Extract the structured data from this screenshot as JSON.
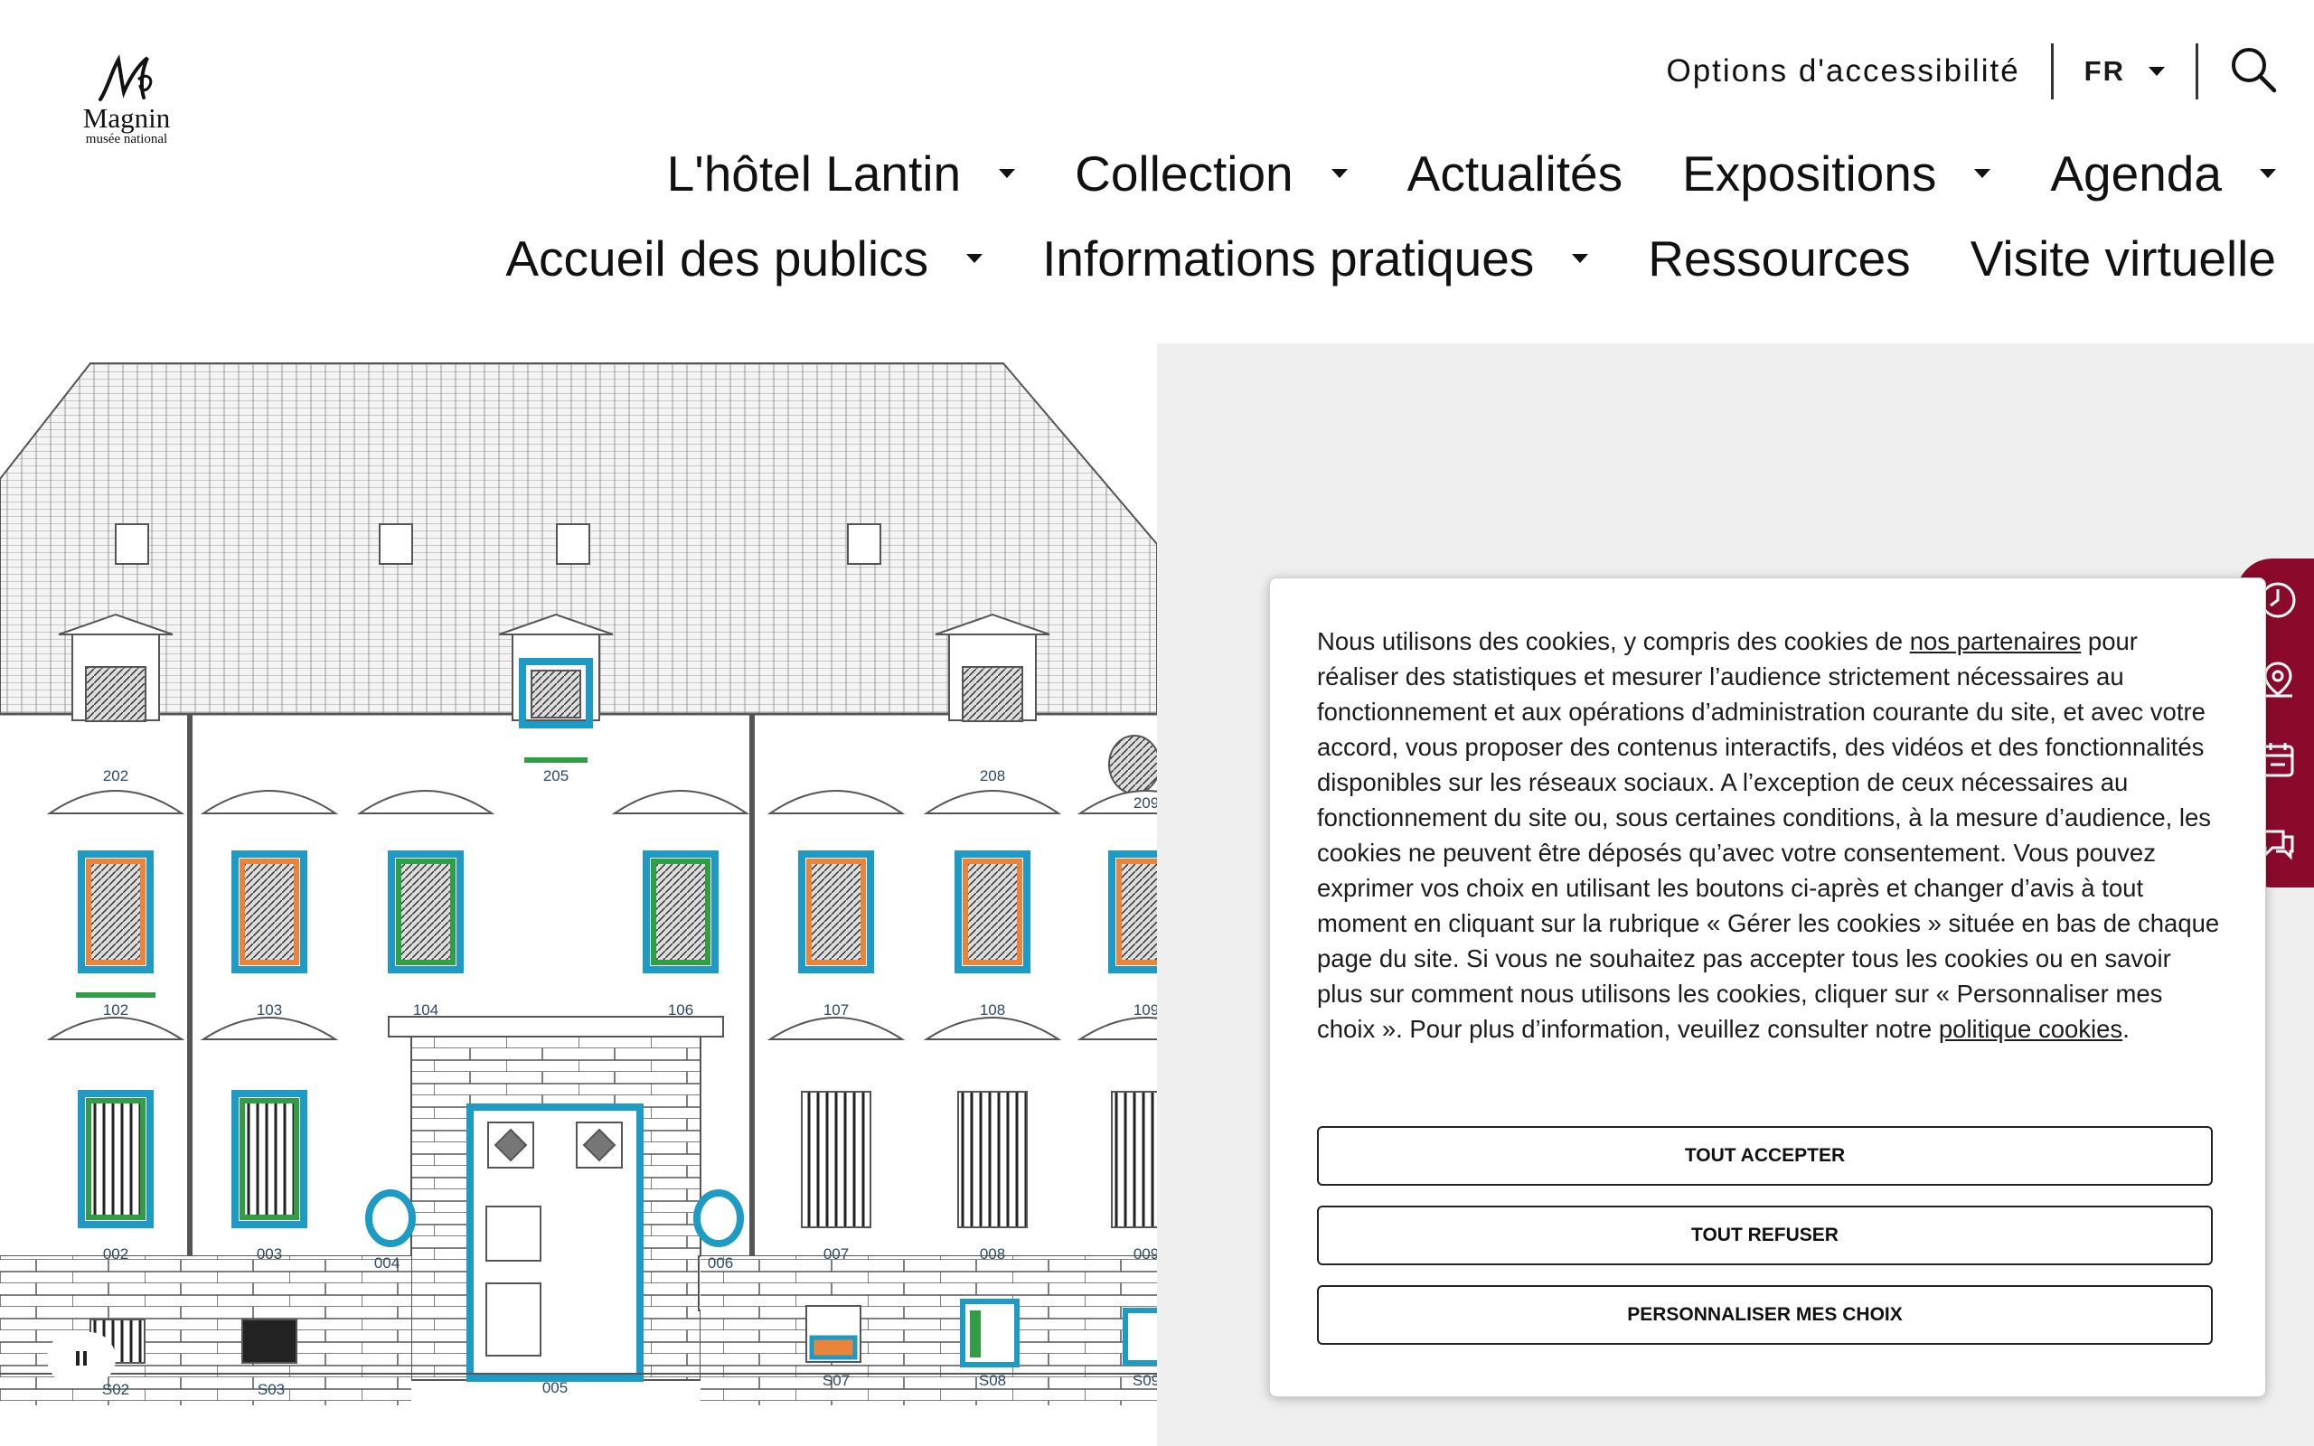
{
  "brand": {
    "monogram": "M",
    "name": "Magnin",
    "subtitle": "musée national"
  },
  "utility": {
    "accessibility": "Options d'accessibilité",
    "language": "FR"
  },
  "nav": {
    "row1": [
      {
        "label": "L'hôtel Lantin",
        "dropdown": true
      },
      {
        "label": "Collection",
        "dropdown": true
      },
      {
        "label": "Actualités",
        "dropdown": false
      },
      {
        "label": "Expositions",
        "dropdown": true
      },
      {
        "label": "Agenda",
        "dropdown": true
      }
    ],
    "row2": [
      {
        "label": "Accueil des publics",
        "dropdown": true
      },
      {
        "label": "Informations pratiques",
        "dropdown": true
      },
      {
        "label": "Ressources",
        "dropdown": false
      },
      {
        "label": "Visite virtuelle",
        "dropdown": false
      }
    ]
  },
  "facade": {
    "labels": {
      "l202": "202",
      "l205": "205",
      "l208": "208",
      "l209": "209",
      "l102": "102",
      "l103": "103",
      "l104": "104",
      "l106": "106",
      "l107": "107",
      "l108": "108",
      "l109": "109",
      "l002": "002",
      "l003": "003",
      "l004": "004",
      "l006": "006",
      "l007": "007",
      "l008": "008",
      "l009": "009",
      "ls02": "S02",
      "ls03": "S03",
      "l005": "005",
      "ls07": "S07",
      "ls08": "S08",
      "ls09": "S09"
    }
  },
  "cookie": {
    "part1": "Nous utilisons des cookies, y compris des cookies de ",
    "link_partners": "nos partenaires",
    "part2": " pour réaliser des statistiques et mesurer l’audience strictement nécessaires au fonctionnement et aux opérations d’administration courante du site, et avec votre accord, vous proposer des contenus interactifs, des vidéos et des fonctionnalités disponibles sur les réseaux sociaux. A l’exception de ceux nécessaires au fonctionnement du site ou, sous certaines conditions, à la mesure d’audience, les cookies ne peuvent être déposés qu’avec votre consentement. Vous pouvez exprimer vos choix en utilisant les boutons ci-après et changer d’avis à tout moment en cliquant sur la rubrique « Gérer les cookies » située en bas de chaque page du site. Si vous ne souhaitez pas accepter tous les cookies ou en savoir plus sur comment nous utilisons les cookies, cliquer sur « Personnaliser mes choix ». Pour plus d’information, veuillez consulter notre ",
    "link_policy": "politique cookies",
    "part3": ".",
    "accept": "TOUT ACCEPTER",
    "refuse": "TOUT REFUSER",
    "customize": "PERSONNALISER MES CHOIX"
  },
  "sidebar_icons": [
    "clock-icon",
    "map-pin-icon",
    "ticket-icon",
    "chat-icon"
  ],
  "colors": {
    "accent": "#8b0a2b",
    "teal": "#1e9bc4",
    "orange": "#e8853a",
    "green": "#2f9e45"
  }
}
